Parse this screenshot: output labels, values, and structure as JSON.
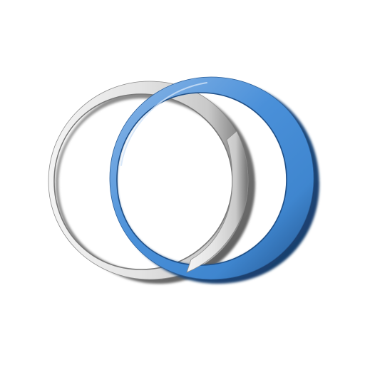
{
  "logo": {
    "name": "interlocking-rings-logo",
    "left_ring": {
      "name": "silver-ring",
      "colors": {
        "highlight": "#f4f4f4",
        "mid": "#c9c9c9",
        "shadow": "#6f6f6f",
        "edge": "#8c8c8c"
      }
    },
    "right_ring": {
      "name": "blue-ring",
      "colors": {
        "highlight": "#8fb9e8",
        "mid": "#3f86cf",
        "shadow": "#1f4f87",
        "edge": "#2c5f99"
      }
    }
  },
  "background_color": "#ffffff"
}
